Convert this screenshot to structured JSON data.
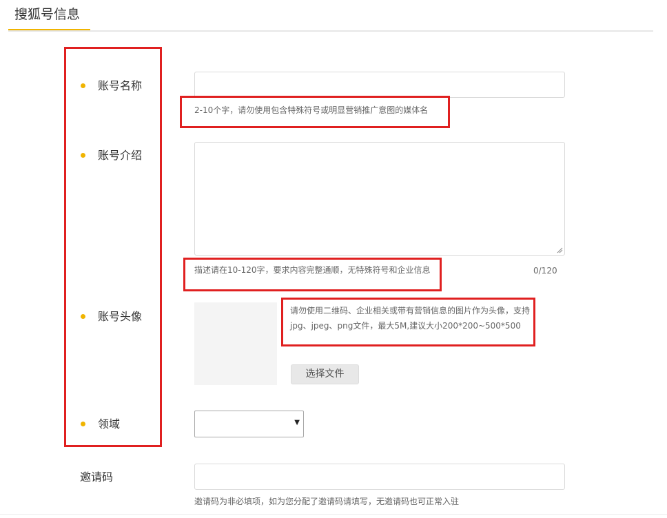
{
  "header": {
    "title": "搜狐号信息"
  },
  "form": {
    "account_name": {
      "label": "账号名称",
      "hint": "2-10个字，请勿使用包含特殊符号或明显营销推广意图的媒体名"
    },
    "account_intro": {
      "label": "账号介绍",
      "hint": "描述请在10-120字，要求内容完整通顺，无特殊符号和企业信息",
      "counter": "0/120"
    },
    "account_avatar": {
      "label": "账号头像",
      "hint_line1": "请勿使用二维码、企业相关或带有营销信息的图片作为头像，支持",
      "hint_line2": "jpg、jpeg、png文件，最大5M,建议大小200*200~500*500",
      "choose_file_label": "选择文件"
    },
    "domain": {
      "label": "领域",
      "selected_value": ""
    },
    "invite_code": {
      "label": "邀请码",
      "hint": "邀请码为非必填项，如为您分配了邀请码请填写，无邀请码也可正常入驻"
    }
  },
  "colors": {
    "accent": "#f0b400",
    "annotation_red": "#e02020"
  }
}
